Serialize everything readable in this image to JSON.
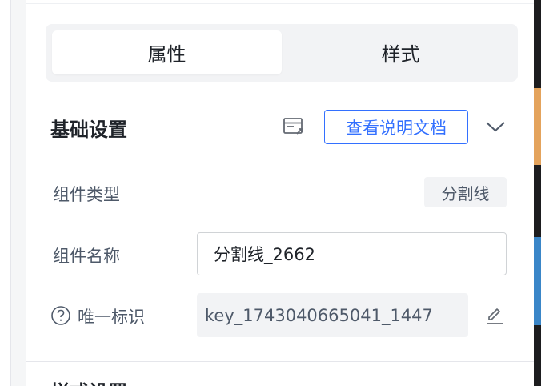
{
  "tabs": [
    {
      "label": "属性",
      "active": true
    },
    {
      "label": "样式",
      "active": false
    }
  ],
  "section": {
    "title": "基础设置",
    "doc_button_label": "查看说明文档",
    "icons": {
      "doc": "window-link-icon",
      "collapse": "chevron-down-icon"
    }
  },
  "fields": {
    "component_type": {
      "label": "组件类型",
      "value": "分割线"
    },
    "component_name": {
      "label": "组件名称",
      "value": "分割线_2662"
    },
    "unique_id": {
      "label": "唯一标识",
      "value": "key_1743040665041_1447",
      "help_icon": "question-circle-icon",
      "edit_icon": "edit-pencil-icon"
    }
  },
  "next_section": {
    "title": "样式设置"
  },
  "colors": {
    "accent": "#3370ff",
    "label": "#4e5969",
    "field_bg": "#f2f3f5"
  }
}
